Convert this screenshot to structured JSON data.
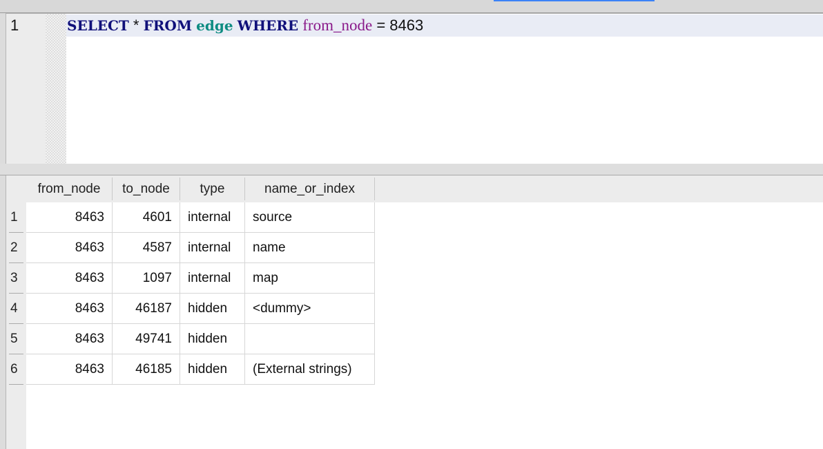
{
  "editor": {
    "line_number": "1",
    "query": {
      "kw_select": "SELECT",
      "star": "*",
      "kw_from": "FROM",
      "table": "edge",
      "kw_where": "WHERE",
      "column": "from_node",
      "operator": "=",
      "value": "8463"
    },
    "colors": {
      "keyword": "#10107a",
      "table": "#0e8c82",
      "column": "#8a1a8a",
      "current_line": "#e9ecf5"
    }
  },
  "results": {
    "columns": [
      "from_node",
      "to_node",
      "type",
      "name_or_index"
    ],
    "rows": [
      {
        "n": "1",
        "cells": [
          "8463",
          "4601",
          "internal",
          "source"
        ]
      },
      {
        "n": "2",
        "cells": [
          "8463",
          "4587",
          "internal",
          "name"
        ]
      },
      {
        "n": "3",
        "cells": [
          "8463",
          "1097",
          "internal",
          "map"
        ]
      },
      {
        "n": "4",
        "cells": [
          "8463",
          "46187",
          "hidden",
          "<dummy>"
        ]
      },
      {
        "n": "5",
        "cells": [
          "8463",
          "49741",
          "hidden",
          ""
        ]
      },
      {
        "n": "6",
        "cells": [
          "8463",
          "46185",
          "hidden",
          "(External strings)"
        ]
      }
    ]
  }
}
